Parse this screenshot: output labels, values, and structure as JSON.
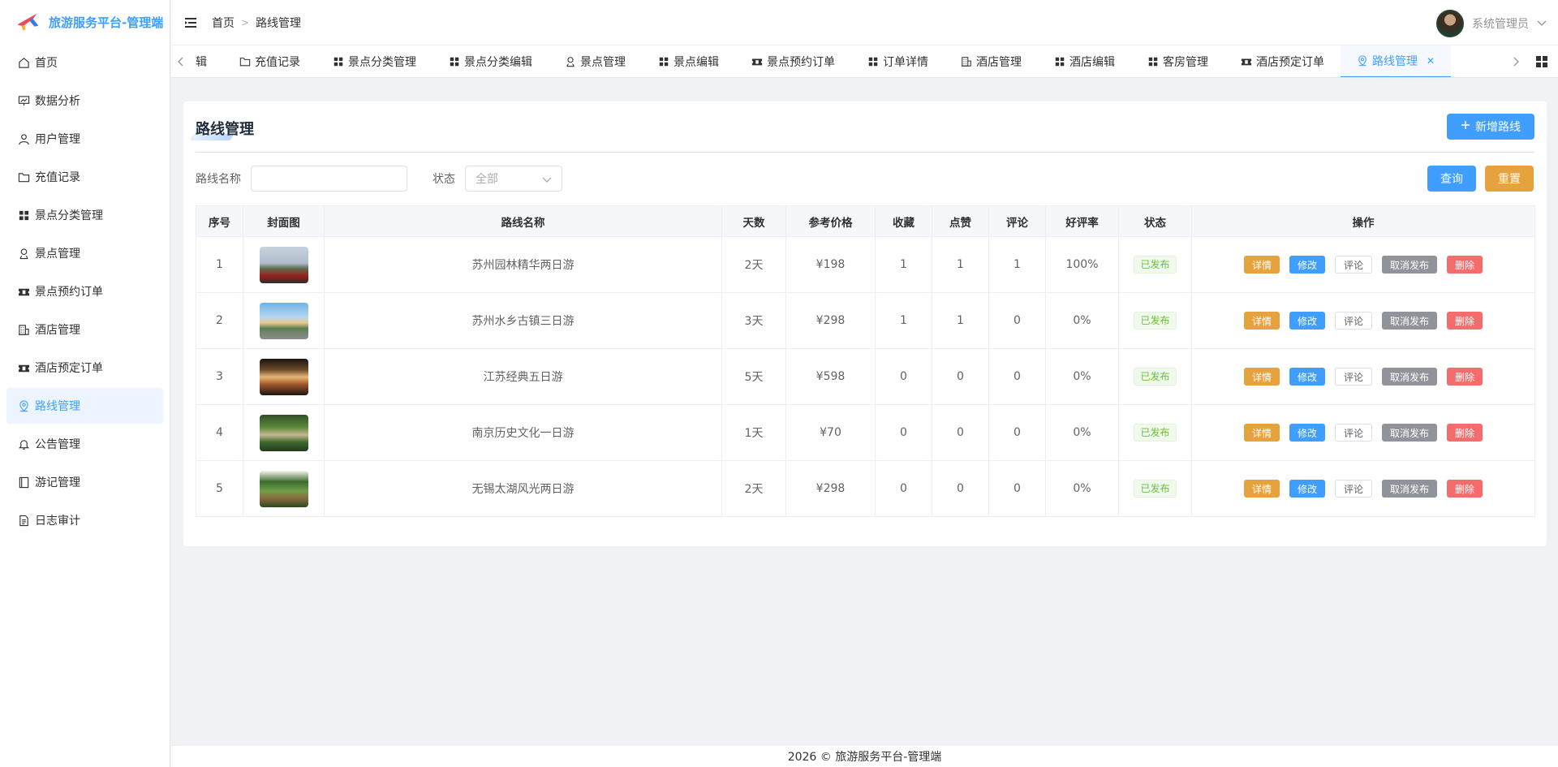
{
  "app": {
    "title": "旅游服务平台-管理端"
  },
  "sidebar": {
    "items": [
      {
        "label": "首页",
        "icon": "home-icon"
      },
      {
        "label": "数据分析",
        "icon": "presentation-chart-icon"
      },
      {
        "label": "用户管理",
        "icon": "user-icon"
      },
      {
        "label": "充值记录",
        "icon": "folder-icon"
      },
      {
        "label": "景点分类管理",
        "icon": "grid-icon"
      },
      {
        "label": "景点管理",
        "icon": "person-pin-icon"
      },
      {
        "label": "景点预约订单",
        "icon": "ticket-icon"
      },
      {
        "label": "酒店管理",
        "icon": "building-icon"
      },
      {
        "label": "酒店预定订单",
        "icon": "ticket-icon"
      },
      {
        "label": "路线管理",
        "icon": "location-icon",
        "active": true
      },
      {
        "label": "公告管理",
        "icon": "bell-icon"
      },
      {
        "label": "游记管理",
        "icon": "notebook-icon"
      },
      {
        "label": "日志审计",
        "icon": "document-icon"
      }
    ]
  },
  "header": {
    "breadcrumb": [
      "首页",
      "路线管理"
    ],
    "user_name": "系统管理员"
  },
  "tabs": [
    {
      "label": "辑",
      "icon": ""
    },
    {
      "label": "充值记录",
      "icon": "folder-icon"
    },
    {
      "label": "景点分类管理",
      "icon": "grid-icon"
    },
    {
      "label": "景点分类编辑",
      "icon": "grid-icon"
    },
    {
      "label": "景点管理",
      "icon": "person-pin-icon"
    },
    {
      "label": "景点编辑",
      "icon": "grid-icon"
    },
    {
      "label": "景点预约订单",
      "icon": "ticket-icon"
    },
    {
      "label": "订单详情",
      "icon": "grid-icon"
    },
    {
      "label": "酒店管理",
      "icon": "building-icon"
    },
    {
      "label": "酒店编辑",
      "icon": "grid-icon"
    },
    {
      "label": "客房管理",
      "icon": "grid-icon"
    },
    {
      "label": "酒店预定订单",
      "icon": "ticket-icon"
    },
    {
      "label": "路线管理",
      "icon": "location-icon",
      "active": true
    }
  ],
  "page": {
    "title": "路线管理",
    "add_button": "新增路线",
    "filter": {
      "name_label": "路线名称",
      "name_value": "",
      "status_label": "状态",
      "status_value": "全部"
    },
    "query_button": "查询",
    "reset_button": "重置"
  },
  "table": {
    "columns": [
      "序号",
      "封面图",
      "路线名称",
      "天数",
      "参考价格",
      "收藏",
      "点赞",
      "评论",
      "好评率",
      "状态",
      "操作"
    ],
    "rows": [
      {
        "no": "1",
        "name": "苏州园林精华两日游",
        "days": "2天",
        "price": "¥198",
        "fav": "1",
        "like": "1",
        "comment": "1",
        "rate": "100%",
        "status": "已发布"
      },
      {
        "no": "2",
        "name": "苏州水乡古镇三日游",
        "days": "3天",
        "price": "¥298",
        "fav": "1",
        "like": "1",
        "comment": "0",
        "rate": "0%",
        "status": "已发布"
      },
      {
        "no": "3",
        "name": "江苏经典五日游",
        "days": "5天",
        "price": "¥598",
        "fav": "0",
        "like": "0",
        "comment": "0",
        "rate": "0%",
        "status": "已发布"
      },
      {
        "no": "4",
        "name": "南京历史文化一日游",
        "days": "1天",
        "price": "¥70",
        "fav": "0",
        "like": "0",
        "comment": "0",
        "rate": "0%",
        "status": "已发布"
      },
      {
        "no": "5",
        "name": "无锡太湖风光两日游",
        "days": "2天",
        "price": "¥298",
        "fav": "0",
        "like": "0",
        "comment": "0",
        "rate": "0%",
        "status": "已发布"
      }
    ],
    "actions": [
      "详情",
      "修改",
      "评论",
      "取消发布",
      "删除"
    ]
  },
  "footer": {
    "text": "2026 © 旅游服务平台-管理端"
  }
}
